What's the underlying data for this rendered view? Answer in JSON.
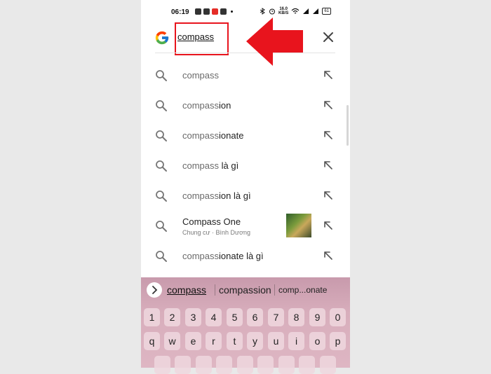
{
  "status_bar": {
    "time": "06:19",
    "network_speed_top": "16.0",
    "network_speed_bottom": "KB/S",
    "battery": "61"
  },
  "search": {
    "query": "compass",
    "clear_icon": "close-icon",
    "logo_icon": "google-logo"
  },
  "suggestions": [
    {
      "prefix": "compass",
      "rest": ""
    },
    {
      "prefix": "compass",
      "rest": "ion"
    },
    {
      "prefix": "compass",
      "rest": "ionate"
    },
    {
      "prefix": "compass",
      "rest": " là gì"
    },
    {
      "prefix": "compass",
      "rest": "ion là gì"
    },
    {
      "title": "Compass One",
      "subtitle": "Chung cư · Bình Dương"
    },
    {
      "prefix": "compass",
      "rest": "ionate là gì"
    }
  ],
  "keyboard": {
    "suggestions": [
      "compass",
      "compassion",
      "comp...onate"
    ],
    "number_row": [
      "1",
      "2",
      "3",
      "4",
      "5",
      "6",
      "7",
      "8",
      "9",
      "0"
    ],
    "letter_row": [
      "q",
      "w",
      "e",
      "r",
      "t",
      "y",
      "u",
      "i",
      "o",
      "p"
    ]
  },
  "colors": {
    "highlight_red": "#e8141d",
    "keyboard_pink": "#d8aebc"
  }
}
